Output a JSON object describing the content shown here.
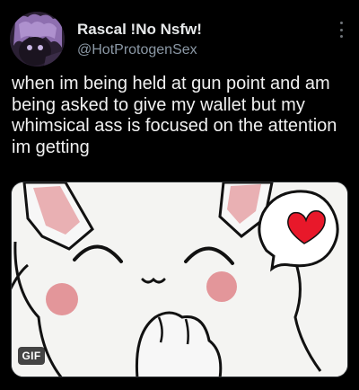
{
  "author": {
    "display_name": "Rascal !No Nsfw!",
    "handle": "@HotProtogenSex",
    "avatar_icon": "profile-avatar"
  },
  "header": {
    "more_icon": "more-options-icon"
  },
  "tweet": {
    "text": "when im being held at gun point and am being asked to give my wallet but my whimsical ass is focused on the attention im getting"
  },
  "media": {
    "badge_label": "GIF",
    "heart_color": "#e8182a",
    "blush_color": "#e3969a"
  },
  "colors": {
    "background": "#000000",
    "name_text": "#e7e9ea",
    "handle_text": "#8b98a5"
  }
}
